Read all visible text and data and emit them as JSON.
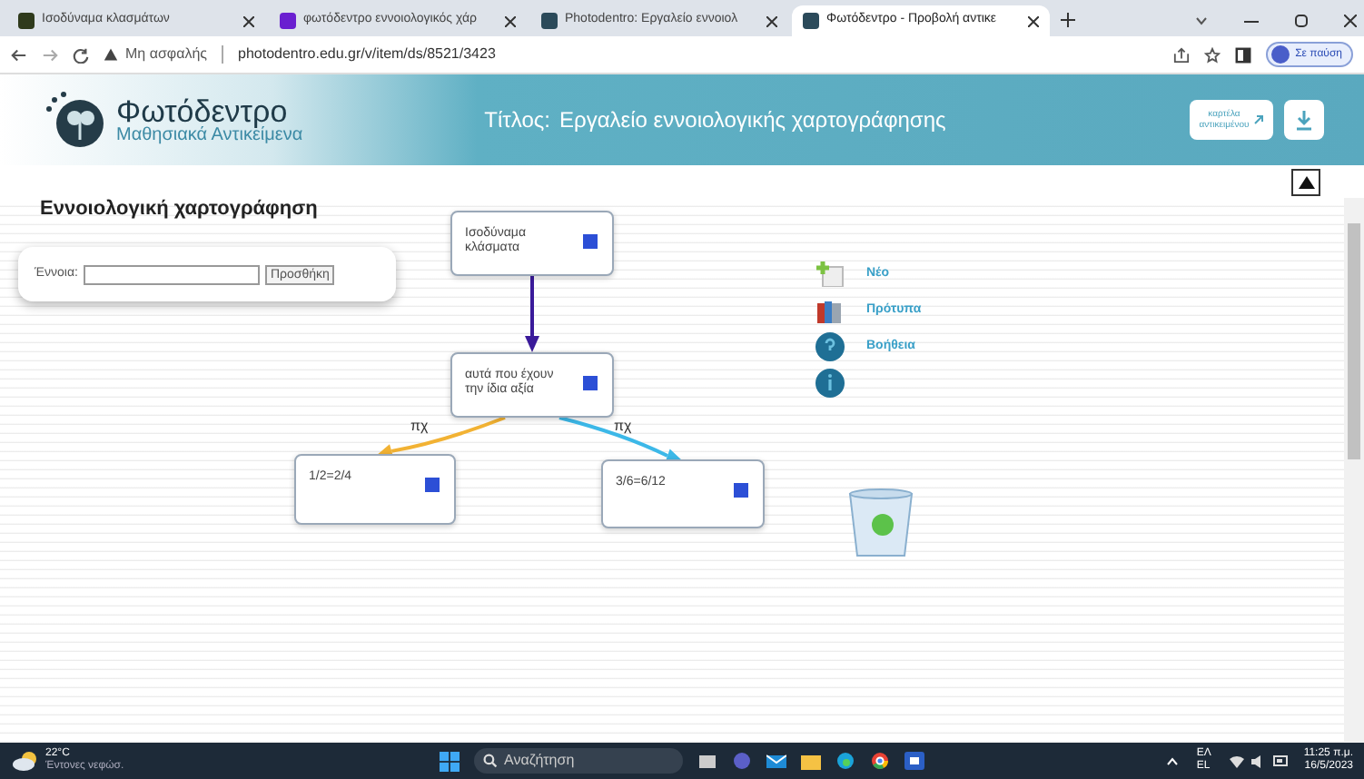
{
  "browser": {
    "tabs": [
      {
        "label": "Ισοδύναμα κλασμάτων",
        "selected": false
      },
      {
        "label": "φωτόδεντρο εννοιολογικός χάρ",
        "selected": false
      },
      {
        "label": "Photodentro: Εργαλείο εννοιολ",
        "selected": false
      },
      {
        "label": "Φωτόδεντρο - Προβολή αντικε",
        "selected": true
      }
    ],
    "security": "Μη ασφαλής",
    "url": "photodentro.edu.gr/v/item/ds/8521/3423",
    "profile": "Σε παύση"
  },
  "header": {
    "logo_title": "Φωτόδεντρο",
    "logo_subtitle": "Μαθησιακά Αντικείμενα",
    "title_label": "Τίτλος:",
    "title": "Εργαλείο εννοιολογικής χαρτογράφησης",
    "card_button": [
      "καρτέλα",
      "αντικειμένου"
    ]
  },
  "tool": {
    "heading": "Εννοιολογική χαρτογράφηση",
    "concept_label": "Έννοια:",
    "add_button": "Προσθήκη",
    "nodes": [
      {
        "text": "Ισοδύναμα κλάσματα"
      },
      {
        "text": "αυτά που έχουν την ίδια αξία"
      },
      {
        "text": "1/2=2/4"
      },
      {
        "text": "3/6=6/12"
      }
    ],
    "edges": [
      {
        "color": "#3a1a9a"
      },
      {
        "label": "πχ",
        "color": "#f2b233"
      },
      {
        "label": "πχ",
        "color": "#3cb8e8"
      }
    ],
    "menu": [
      {
        "kind": "new",
        "label": "Νέο"
      },
      {
        "kind": "templates",
        "label": "Πρότυπα"
      },
      {
        "kind": "help",
        "label": "Βοήθεια"
      },
      {
        "kind": "info"
      }
    ]
  },
  "taskbar": {
    "temperature": "22°C",
    "weather": "Έντονες νεφώσ.",
    "search": "Αναζήτηση",
    "language": [
      "ΕΛ",
      "EL"
    ],
    "time": "11:25 π.μ.",
    "date": "16/5/2023"
  }
}
